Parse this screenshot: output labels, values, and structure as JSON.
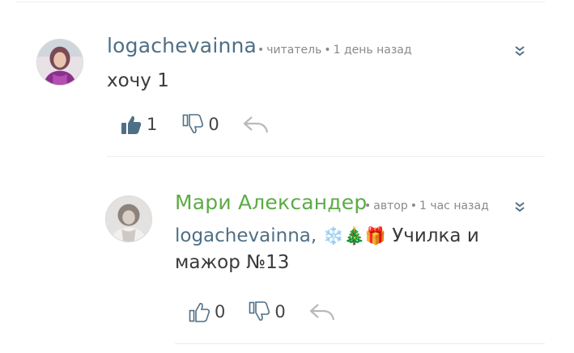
{
  "comments": [
    {
      "author": "logachevainna",
      "author_color": "#4f6f86",
      "role": "читатель",
      "time": "1 день назад",
      "text": "хочу 1",
      "likes": "1",
      "dislikes": "0",
      "liked": true
    },
    {
      "author": "Мари Александер",
      "author_color": "#5cab45",
      "role": "автор",
      "time": "1 час назад",
      "mention": "logachevainna,",
      "emoji": "❄️🎄🎁",
      "text_part1": "Училка и",
      "text_part2": "мажор №13",
      "likes": "0",
      "dislikes": "0",
      "liked": false
    }
  ],
  "separator": "•",
  "icons": {
    "expand": "double-chevron-down-icon",
    "like": "thumbs-up-icon",
    "dislike": "thumbs-down-icon",
    "reply": "reply-arrow-icon"
  },
  "colors": {
    "author_reader": "#4f6f86",
    "author_writer": "#5cab45",
    "like_active": "#4f6f86",
    "icon_inactive": "#4f6f86",
    "reply_icon": "#b9b9b9",
    "meta_text": "#8a8a8a"
  }
}
